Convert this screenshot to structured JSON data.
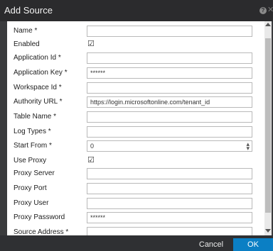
{
  "dialog": {
    "title": "Add Source",
    "help_glyph": "?",
    "close_glyph": "✕"
  },
  "fields": [
    {
      "label": "Name *",
      "type": "text",
      "value": ""
    },
    {
      "label": "Enabled",
      "type": "checkbox",
      "checked": true
    },
    {
      "label": "Application Id *",
      "type": "text",
      "value": ""
    },
    {
      "label": "Application Key *",
      "type": "password",
      "value": "******"
    },
    {
      "label": "Workspace Id *",
      "type": "text",
      "value": ""
    },
    {
      "label": "Authority URL *",
      "type": "text",
      "value": "https://login.microsoftonline.com/tenant_id"
    },
    {
      "label": "Table Name *",
      "type": "text",
      "value": ""
    },
    {
      "label": "Log Types *",
      "type": "text",
      "value": ""
    },
    {
      "label": "Start From *",
      "type": "number",
      "value": "0"
    },
    {
      "label": "Use Proxy",
      "type": "checkbox",
      "checked": true
    },
    {
      "label": "Proxy Server",
      "type": "text",
      "value": ""
    },
    {
      "label": "Proxy Port",
      "type": "text",
      "value": ""
    },
    {
      "label": "Proxy User",
      "type": "text",
      "value": ""
    },
    {
      "label": "Proxy Password",
      "type": "password",
      "value": "******"
    },
    {
      "label": "Source Address *",
      "type": "text",
      "value": ""
    }
  ],
  "checkbox_glyph": "☑",
  "buttons": {
    "cancel": "Cancel",
    "ok": "OK"
  },
  "colors": {
    "ok_button": "#0b7fc4",
    "title_bar": "#2b2b2d"
  }
}
